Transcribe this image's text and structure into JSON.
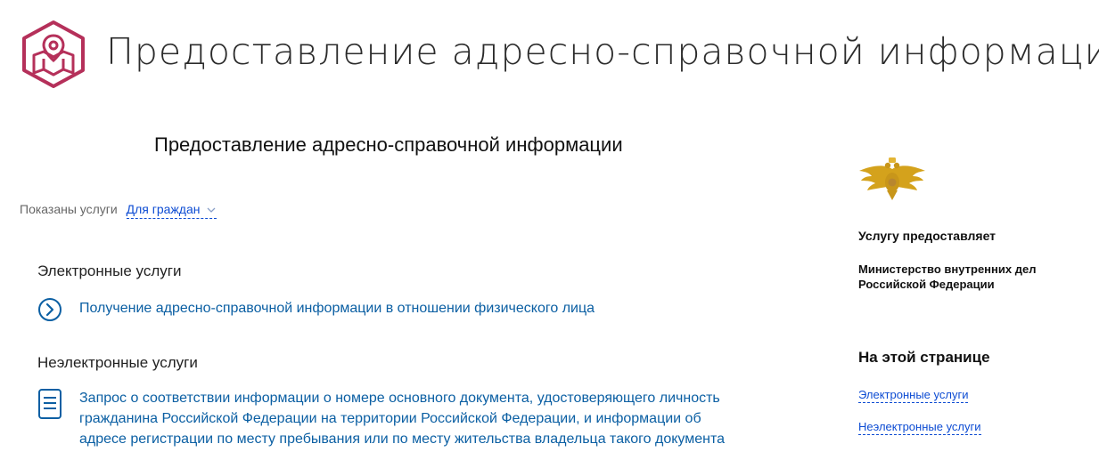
{
  "header": {
    "title": "Предоставление адресно-справочной информации",
    "icon": "map-pin-icon"
  },
  "content": {
    "subtitle": "Предоставление адресно-справочной информации",
    "filter": {
      "label": "Показаны услуги",
      "selected": "Для граждан"
    },
    "electronic": {
      "heading": "Электронные услуги",
      "items": [
        {
          "label": "Получение адресно-справочной информации в отношении физического лица"
        }
      ]
    },
    "non_electronic": {
      "heading": "Неэлектронные услуги",
      "items": [
        {
          "lines": [
            "Запрос о соответствии информации о номере основного документа, удостоверяющего личность",
            "гражданина Российской Федерации на территории Российской Федерации, и информации об",
            "адресе регистрации по месту пребывания или по месту жительства владельца такого документа"
          ]
        }
      ]
    }
  },
  "sidebar": {
    "provider_label": "Услугу предоставляет",
    "provider_name_line1": "Министерство внутренних дел",
    "provider_name_line2": "Российской Федерации",
    "on_page_heading": "На этой странице",
    "links": [
      "Электронные услуги",
      "Неэлектронные услуги"
    ]
  },
  "colors": {
    "brand": "#b5305a",
    "link": "#0d4cd3",
    "service_link": "#0b5fa3"
  }
}
